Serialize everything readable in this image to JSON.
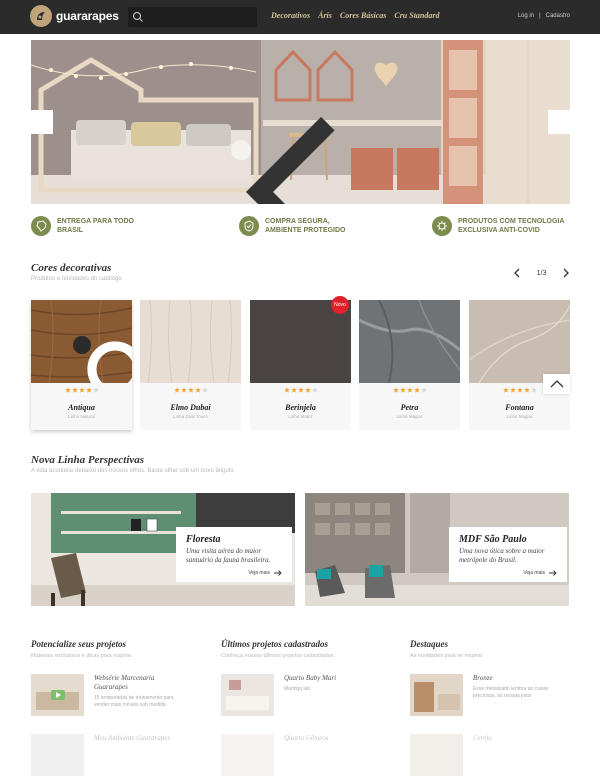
{
  "header": {
    "logo_text": "guararapes",
    "search_placeholder": "",
    "nav": [
      "Decorativos",
      "Áris",
      "Cores Básicas",
      "Cru Standard"
    ],
    "login": "Log in",
    "separator": "|",
    "signup": "Cadastro"
  },
  "features": [
    {
      "line1": "ENTREGA PARA TODO",
      "line2": "BRASIL",
      "icon": "brazil-map-icon"
    },
    {
      "line1": "COMPRA SEGURA,",
      "line2": "AMBIENTE PROTEGIDO",
      "icon": "shield-check-icon"
    },
    {
      "line1": "PRODUTOS COM TECNOLOGIA",
      "line2": "EXCLUSIVA ANTI-COVID",
      "icon": "virus-icon"
    }
  ],
  "decorative": {
    "title": "Cores decorativas",
    "subtitle": "Produtos e novidades do catálogo",
    "pager": "1/3",
    "cards": [
      {
        "name": "Antiqua",
        "line": "Linha Natural",
        "rating": 4,
        "color": "#8a5a33",
        "badge": ""
      },
      {
        "name": "Elmo Dubai",
        "line": "Linha Dual Touch",
        "rating": 4,
        "color": "#e7ddd2",
        "badge": ""
      },
      {
        "name": "Berinjela",
        "line": "Linha Matriz",
        "rating": 4,
        "color": "#4a4444",
        "badge": "Novo"
      },
      {
        "name": "Petra",
        "line": "Linha Magna",
        "rating": 4,
        "color": "#707375",
        "badge": ""
      },
      {
        "name": "Fontana",
        "line": "Linha Magna",
        "rating": 4,
        "color": "#c9bdb2",
        "badge": ""
      }
    ]
  },
  "perspectives": {
    "title": "Nova Linha Perspectivas",
    "subtitle": "A vida acontece debaixo dos nossos olhos. Basta olhar sob um novo ângulo.",
    "items": [
      {
        "title": "Floresta",
        "desc1": "Uma visita aérea do maior",
        "desc2": "santuário da fauna brasileira.",
        "more": "Veja mais"
      },
      {
        "title": "MDF São Paulo",
        "desc1": "Uma nova ótica sobre a maior",
        "desc2": "metrópole do Brasil.",
        "more": "Veja mais"
      }
    ]
  },
  "columns": [
    {
      "title": "Potencialize seus projetos",
      "subtitle": "Materiais exclusivos e dicas para inspirar.",
      "items": [
        {
          "title1": "Websérie Marcenaria",
          "title2": "Guararapes",
          "desc1": "15 temporadas de treinamento para",
          "desc2": "vender mais móveis sob medida"
        },
        {
          "title1": "Meu Ambiente Guararapes",
          "title2": "",
          "desc1": "",
          "desc2": ""
        }
      ]
    },
    {
      "title": "Últimos projetos cadastrados",
      "subtitle": "Conheça nossos últimos projetos cadastrados.",
      "items": [
        {
          "title1": "Quarto Baby Mari",
          "title2": "",
          "desc1": "Maringa.lab",
          "desc2": ""
        },
        {
          "title1": "Quarto Gêmeos",
          "title2": "",
          "desc1": "",
          "desc2": ""
        }
      ]
    },
    {
      "title": "Destaques",
      "subtitle": "As novidades para se inspirar.",
      "items": [
        {
          "title1": "Bronze",
          "title2": "",
          "desc1": "Esse metalizado lembra as coisas",
          "desc2": "preciosas, às nossas joias"
        },
        {
          "title1": "Cerejo",
          "title2": "",
          "desc1": "",
          "desc2": ""
        }
      ]
    }
  ],
  "colors": {
    "accent": "#6e7b46",
    "header": "#2b2b2b",
    "nav": "#d8c39a",
    "star": "#f0a53a"
  }
}
